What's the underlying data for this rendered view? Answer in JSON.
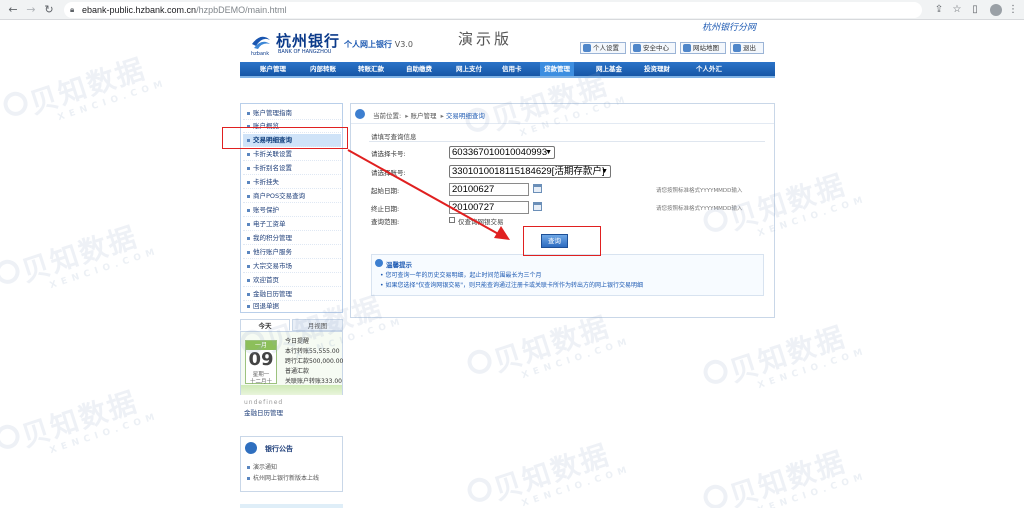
{
  "browser": {
    "back": "←",
    "forward": "→",
    "reload": "↻",
    "url_host": "ebank-public.hzbank.com.cn",
    "url_path": "/hzpbDEMO/main.html"
  },
  "bank": {
    "logo_cn": "杭州银行",
    "logo_en": "BANK OF HANGZHOU",
    "logo_sub": "hzbank",
    "product": "个人网上银行",
    "version": "V3.0",
    "demo_title": "演示版",
    "slogan": "杭州银行分网"
  },
  "top_links": [
    "个人设置",
    "安全中心",
    "网站地图",
    "退出"
  ],
  "main_nav": [
    "账户管理",
    "内部转账",
    "转账汇款",
    "自助缴费",
    "网上支付",
    "信用卡",
    "贷款管理",
    "网上基金",
    "投资理财",
    "个人外汇"
  ],
  "sidebar": {
    "items": [
      "账户管理指南",
      "账户概览",
      "交易明细查询",
      "卡折关联设置",
      "卡折别名设置",
      "卡折挂失",
      "商户POS交易查询",
      "账号保护",
      "电子工资单",
      "我的积分管理",
      "他行账户服务",
      "大宗交易市场",
      "欢迎首页",
      "金融日历管理",
      "回退单据"
    ],
    "selected_index": 2
  },
  "calendar": {
    "tab_today": "今天",
    "tab_month": "月视图",
    "month": "一月",
    "day": "09",
    "weekday": "星期一",
    "lunar": "十二月十",
    "lines": [
      "今日提醒",
      "本行转账55,555.00",
      "跨行汇款500,000.00",
      "普通汇款",
      "关联账户转账333.00"
    ],
    "undefined_text": "undefined",
    "manage_link": "金融日历管理"
  },
  "bulletin": {
    "title": "银行公告",
    "items": [
      "演示通知",
      "杭州网上银行新版本上线"
    ]
  },
  "content": {
    "breadcrumb_label": "当前位置:",
    "breadcrumb_parent": "账户管理",
    "breadcrumb_current": "交易明细查询",
    "form_title": "请填写查询信息",
    "labels": {
      "card": "请选择卡号:",
      "account": "请选择账号:",
      "start": "起始日期:",
      "end": "终止日期:",
      "range": "查询范围:"
    },
    "card_value": "603367010010040993",
    "account_value": "3301010018115184629[活期存款户]",
    "start_date": "20100627",
    "end_date": "20100727",
    "date_hint": "请您按照标准格式YYYYMMDD输入",
    "range_checkbox_label": "仅查询网银交易",
    "query_button": "查询",
    "tips_title": "温馨提示",
    "tips": [
      "您可查询一年的历史交易明细，起止时间范围最长为三个月",
      "如果您选择\"仅查询网银交易\"，则只能查询通过注册卡或关联卡所作为转出方的网上银行交易明细"
    ]
  },
  "watermark": {
    "cn": "贝知数据",
    "en": "XENCIO.COM"
  },
  "colors": {
    "nav_blue": "#1656a6",
    "annotation_red": "#e02020",
    "link_blue": "#1f5bb3"
  }
}
